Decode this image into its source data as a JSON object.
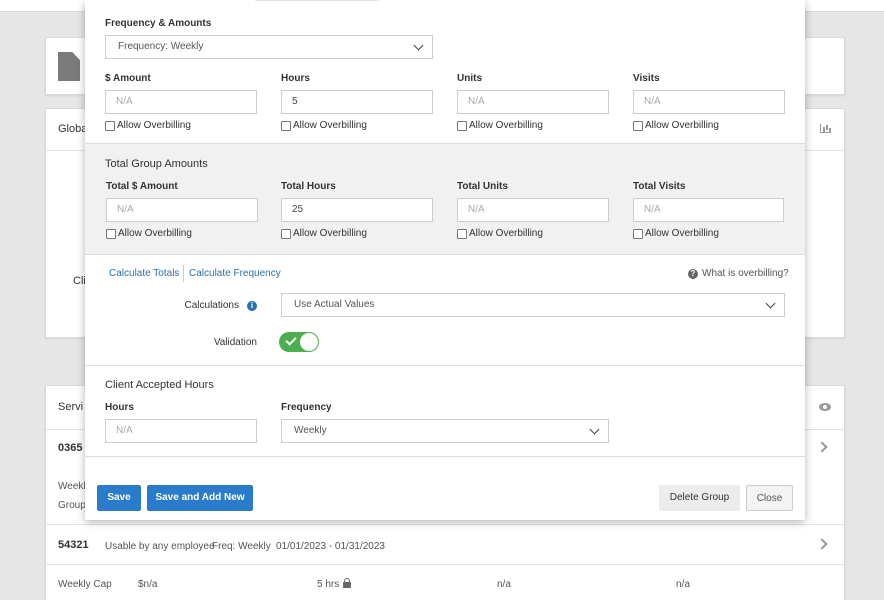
{
  "background": {
    "card2_title_partial": "Globa",
    "card2_side_text": "Cli",
    "card3_title_partial": "Servi",
    "row1_id_partial": "0365",
    "row1_line1_partial": "Weekl",
    "row1_line2_partial": "Group",
    "row2": {
      "id": "54321",
      "usable": "Usable by any employee",
      "freq": "Freq: Weekly",
      "dates": "01/01/2023 - 01/31/2023"
    },
    "row2_detail": {
      "label": "Weekly Cap",
      "amount": "$n/a",
      "hours": "5 hrs",
      "units": "n/a",
      "visits": "n/a"
    }
  },
  "modal": {
    "freq_section": {
      "title": "Frequency & Amounts",
      "frequency_value": "Frequency: Weekly",
      "fields": [
        {
          "label": "$ Amount",
          "value": "",
          "placeholder": "N/A",
          "check_label": "Allow Overbilling"
        },
        {
          "label": "Hours",
          "value": "5",
          "placeholder": "",
          "check_label": "Allow Overbilling"
        },
        {
          "label": "Units",
          "value": "",
          "placeholder": "N/A",
          "check_label": "Allow Overbilling"
        },
        {
          "label": "Visits",
          "value": "",
          "placeholder": "N/A",
          "check_label": "Allow Overbilling"
        }
      ]
    },
    "group_section": {
      "title": "Total Group Amounts",
      "fields": [
        {
          "label": "Total $ Amount",
          "value": "",
          "placeholder": "N/A",
          "check_label": "Allow Overbilling"
        },
        {
          "label": "Total Hours",
          "value": "25",
          "placeholder": "",
          "check_label": "Allow Overbilling"
        },
        {
          "label": "Total Units",
          "value": "",
          "placeholder": "N/A",
          "check_label": "Allow Overbilling"
        },
        {
          "label": "Total Visits",
          "value": "",
          "placeholder": "N/A",
          "check_label": "Allow Overbilling"
        }
      ]
    },
    "calc_section": {
      "link_totals": "Calculate Totals",
      "link_frequency": "Calculate Frequency",
      "help_text": "What is overbilling?",
      "calculations_label": "Calculations",
      "calculations_value": "Use Actual Values",
      "validation_label": "Validation",
      "validation_on": true
    },
    "client_section": {
      "title": "Client Accepted Hours",
      "hours_label": "Hours",
      "hours_placeholder": "N/A",
      "frequency_label": "Frequency",
      "frequency_value": "Weekly"
    },
    "footer": {
      "save": "Save",
      "save_add": "Save and Add New",
      "delete_group": "Delete Group",
      "close": "Close"
    }
  },
  "colors": {
    "primary": "#2a7bc9",
    "toggle_on": "#4cae4c",
    "link": "#2a6fb0"
  }
}
